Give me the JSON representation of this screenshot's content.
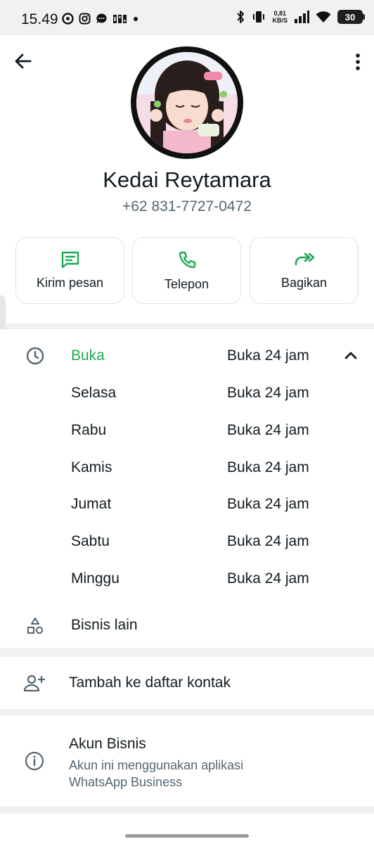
{
  "status_bar": {
    "time": "15.49",
    "net_speed_value": "0,81",
    "net_speed_unit": "KB/S",
    "battery": "30",
    "icons_left": [
      "location-icon",
      "instagram-icon",
      "chat-bubble-icon",
      "smartband-icon",
      "dot-icon"
    ],
    "icons_right": [
      "bluetooth-icon",
      "vibrate-icon",
      "signal-icon",
      "wifi-icon",
      "battery-icon"
    ]
  },
  "header": {
    "back_icon": "arrow-left-icon",
    "menu_icon": "more-vert-icon"
  },
  "profile": {
    "name": "Kedai Reytamara",
    "phone": "+62 831-7727-0472"
  },
  "actions": [
    {
      "label": "Kirim pesan",
      "icon": "message-icon"
    },
    {
      "label": "Telepon",
      "icon": "phone-icon"
    },
    {
      "label": "Bagikan",
      "icon": "share-icon"
    }
  ],
  "hours": {
    "status": "Buka",
    "status_time": "Buka 24 jam",
    "days": [
      {
        "day": "Selasa",
        "time": "Buka 24 jam"
      },
      {
        "day": "Rabu",
        "time": "Buka 24 jam"
      },
      {
        "day": "Kamis",
        "time": "Buka 24 jam"
      },
      {
        "day": "Jumat",
        "time": "Buka 24 jam"
      },
      {
        "day": "Sabtu",
        "time": "Buka 24 jam"
      },
      {
        "day": "Minggu",
        "time": "Buka 24 jam"
      }
    ]
  },
  "other_business": {
    "label": "Bisnis lain"
  },
  "add_contact": {
    "label": "Tambah ke daftar kontak"
  },
  "business_info": {
    "title": "Akun Bisnis",
    "subtitle": "Akun ini menggunakan aplikasi WhatsApp Business"
  },
  "colors": {
    "accent": "#1da851",
    "background": "#f0f1f1",
    "card": "#ffffff",
    "text_primary": "#111b21",
    "text_secondary": "#54656f"
  }
}
